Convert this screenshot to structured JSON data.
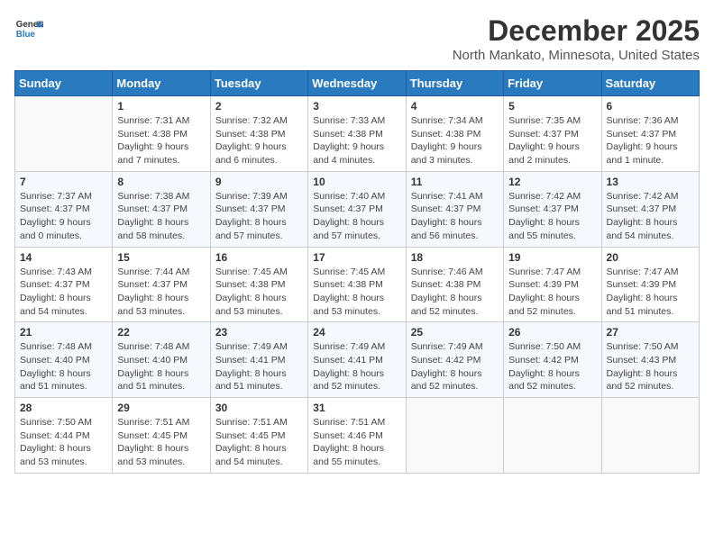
{
  "header": {
    "logo_general": "General",
    "logo_blue": "Blue",
    "title": "December 2025",
    "subtitle": "North Mankato, Minnesota, United States"
  },
  "calendar": {
    "days_of_week": [
      "Sunday",
      "Monday",
      "Tuesday",
      "Wednesday",
      "Thursday",
      "Friday",
      "Saturday"
    ],
    "weeks": [
      [
        {
          "day": "",
          "info": ""
        },
        {
          "day": "1",
          "info": "Sunrise: 7:31 AM\nSunset: 4:38 PM\nDaylight: 9 hours\nand 7 minutes."
        },
        {
          "day": "2",
          "info": "Sunrise: 7:32 AM\nSunset: 4:38 PM\nDaylight: 9 hours\nand 6 minutes."
        },
        {
          "day": "3",
          "info": "Sunrise: 7:33 AM\nSunset: 4:38 PM\nDaylight: 9 hours\nand 4 minutes."
        },
        {
          "day": "4",
          "info": "Sunrise: 7:34 AM\nSunset: 4:38 PM\nDaylight: 9 hours\nand 3 minutes."
        },
        {
          "day": "5",
          "info": "Sunrise: 7:35 AM\nSunset: 4:37 PM\nDaylight: 9 hours\nand 2 minutes."
        },
        {
          "day": "6",
          "info": "Sunrise: 7:36 AM\nSunset: 4:37 PM\nDaylight: 9 hours\nand 1 minute."
        }
      ],
      [
        {
          "day": "7",
          "info": "Sunrise: 7:37 AM\nSunset: 4:37 PM\nDaylight: 9 hours\nand 0 minutes."
        },
        {
          "day": "8",
          "info": "Sunrise: 7:38 AM\nSunset: 4:37 PM\nDaylight: 8 hours\nand 58 minutes."
        },
        {
          "day": "9",
          "info": "Sunrise: 7:39 AM\nSunset: 4:37 PM\nDaylight: 8 hours\nand 57 minutes."
        },
        {
          "day": "10",
          "info": "Sunrise: 7:40 AM\nSunset: 4:37 PM\nDaylight: 8 hours\nand 57 minutes."
        },
        {
          "day": "11",
          "info": "Sunrise: 7:41 AM\nSunset: 4:37 PM\nDaylight: 8 hours\nand 56 minutes."
        },
        {
          "day": "12",
          "info": "Sunrise: 7:42 AM\nSunset: 4:37 PM\nDaylight: 8 hours\nand 55 minutes."
        },
        {
          "day": "13",
          "info": "Sunrise: 7:42 AM\nSunset: 4:37 PM\nDaylight: 8 hours\nand 54 minutes."
        }
      ],
      [
        {
          "day": "14",
          "info": "Sunrise: 7:43 AM\nSunset: 4:37 PM\nDaylight: 8 hours\nand 54 minutes."
        },
        {
          "day": "15",
          "info": "Sunrise: 7:44 AM\nSunset: 4:37 PM\nDaylight: 8 hours\nand 53 minutes."
        },
        {
          "day": "16",
          "info": "Sunrise: 7:45 AM\nSunset: 4:38 PM\nDaylight: 8 hours\nand 53 minutes."
        },
        {
          "day": "17",
          "info": "Sunrise: 7:45 AM\nSunset: 4:38 PM\nDaylight: 8 hours\nand 53 minutes."
        },
        {
          "day": "18",
          "info": "Sunrise: 7:46 AM\nSunset: 4:38 PM\nDaylight: 8 hours\nand 52 minutes."
        },
        {
          "day": "19",
          "info": "Sunrise: 7:47 AM\nSunset: 4:39 PM\nDaylight: 8 hours\nand 52 minutes."
        },
        {
          "day": "20",
          "info": "Sunrise: 7:47 AM\nSunset: 4:39 PM\nDaylight: 8 hours\nand 51 minutes."
        }
      ],
      [
        {
          "day": "21",
          "info": "Sunrise: 7:48 AM\nSunset: 4:40 PM\nDaylight: 8 hours\nand 51 minutes."
        },
        {
          "day": "22",
          "info": "Sunrise: 7:48 AM\nSunset: 4:40 PM\nDaylight: 8 hours\nand 51 minutes."
        },
        {
          "day": "23",
          "info": "Sunrise: 7:49 AM\nSunset: 4:41 PM\nDaylight: 8 hours\nand 51 minutes."
        },
        {
          "day": "24",
          "info": "Sunrise: 7:49 AM\nSunset: 4:41 PM\nDaylight: 8 hours\nand 52 minutes."
        },
        {
          "day": "25",
          "info": "Sunrise: 7:49 AM\nSunset: 4:42 PM\nDaylight: 8 hours\nand 52 minutes."
        },
        {
          "day": "26",
          "info": "Sunrise: 7:50 AM\nSunset: 4:42 PM\nDaylight: 8 hours\nand 52 minutes."
        },
        {
          "day": "27",
          "info": "Sunrise: 7:50 AM\nSunset: 4:43 PM\nDaylight: 8 hours\nand 52 minutes."
        }
      ],
      [
        {
          "day": "28",
          "info": "Sunrise: 7:50 AM\nSunset: 4:44 PM\nDaylight: 8 hours\nand 53 minutes."
        },
        {
          "day": "29",
          "info": "Sunrise: 7:51 AM\nSunset: 4:45 PM\nDaylight: 8 hours\nand 53 minutes."
        },
        {
          "day": "30",
          "info": "Sunrise: 7:51 AM\nSunset: 4:45 PM\nDaylight: 8 hours\nand 54 minutes."
        },
        {
          "day": "31",
          "info": "Sunrise: 7:51 AM\nSunset: 4:46 PM\nDaylight: 8 hours\nand 55 minutes."
        },
        {
          "day": "",
          "info": ""
        },
        {
          "day": "",
          "info": ""
        },
        {
          "day": "",
          "info": ""
        }
      ]
    ]
  }
}
